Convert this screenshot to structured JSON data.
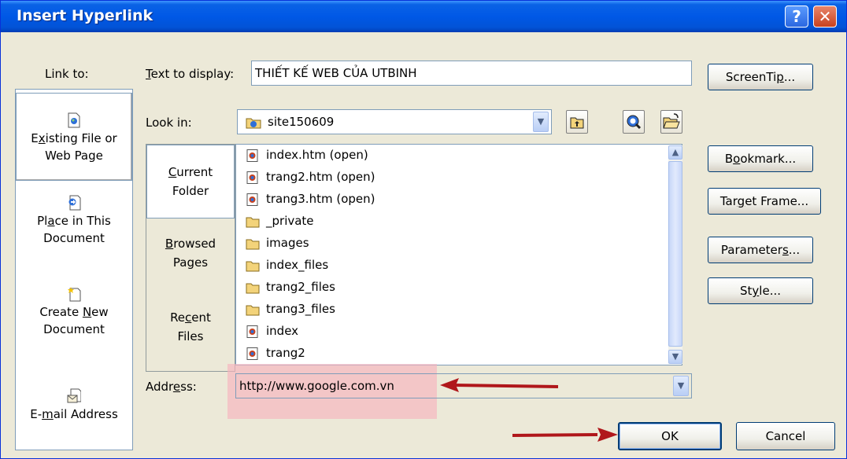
{
  "window": {
    "title": "Insert Hyperlink",
    "help_glyph": "?",
    "close_glyph": "✕"
  },
  "link_to": {
    "label": "Link to:",
    "items": [
      {
        "line1_pre": "E",
        "line1_u": "x",
        "line1_post": "isting File or",
        "line2": "Web Page",
        "icon": "existing-file-icon"
      },
      {
        "line1_pre": "Pl",
        "line1_u": "a",
        "line1_post": "ce in This",
        "line2": "Document",
        "icon": "place-in-document-icon"
      },
      {
        "line1_pre": "Create ",
        "line1_u": "N",
        "line1_post": "ew",
        "line2": "Document",
        "icon": "new-document-icon"
      },
      {
        "line1_pre": "E-",
        "line1_u": "m",
        "line1_post": "ail Address",
        "icon": "email-icon"
      }
    ]
  },
  "text_to_display": {
    "label_u": "T",
    "label_rest": "ext to display:",
    "value": "THIẾT KẾ WEB CỦA UTBINH"
  },
  "screentip": {
    "pre": "ScreenTi",
    "u": "p",
    "post": "..."
  },
  "look_in": {
    "label_pre": "Look in:",
    "value": "site150609"
  },
  "side_tabs": [
    {
      "line1_pre": "",
      "line1_u": "C",
      "line1_post": "urrent",
      "line2": "Folder"
    },
    {
      "line1_pre": "",
      "line1_u": "B",
      "line1_post": "rowsed",
      "line2": "Pages"
    },
    {
      "line1_pre": "Re",
      "line1_u": "c",
      "line1_post": "ent",
      "line2": "Files"
    }
  ],
  "files": [
    {
      "name": "index.htm (open)",
      "type": "page"
    },
    {
      "name": "trang2.htm (open)",
      "type": "page"
    },
    {
      "name": "trang3.htm (open)",
      "type": "page"
    },
    {
      "name": "_private",
      "type": "folder"
    },
    {
      "name": "images",
      "type": "folder"
    },
    {
      "name": "index_files",
      "type": "folder"
    },
    {
      "name": "trang2_files",
      "type": "folder"
    },
    {
      "name": "trang3_files",
      "type": "folder"
    },
    {
      "name": "index",
      "type": "page"
    },
    {
      "name": "trang2",
      "type": "page"
    }
  ],
  "right_buttons": {
    "bookmark": {
      "pre": "B",
      "u": "o",
      "post": "okmark..."
    },
    "target_frame": {
      "pre": "Tar",
      "u": "g",
      "post": "et Frame..."
    },
    "parameters": {
      "pre": "Parameter",
      "u": "s",
      "post": "..."
    },
    "style": {
      "pre": "St",
      "u": "y",
      "post": "le..."
    }
  },
  "address": {
    "label_pre": "Addr",
    "label_u": "e",
    "label_post": "ss:",
    "value": "http://www.google.com.vn"
  },
  "ok_label": "OK",
  "cancel_label": "Cancel",
  "colors": {
    "title_blue": "#0058E6",
    "dialog_bg": "#ECE9D8",
    "annotation_red": "#B0171B",
    "highlight_pink": "#F8B4BE"
  }
}
